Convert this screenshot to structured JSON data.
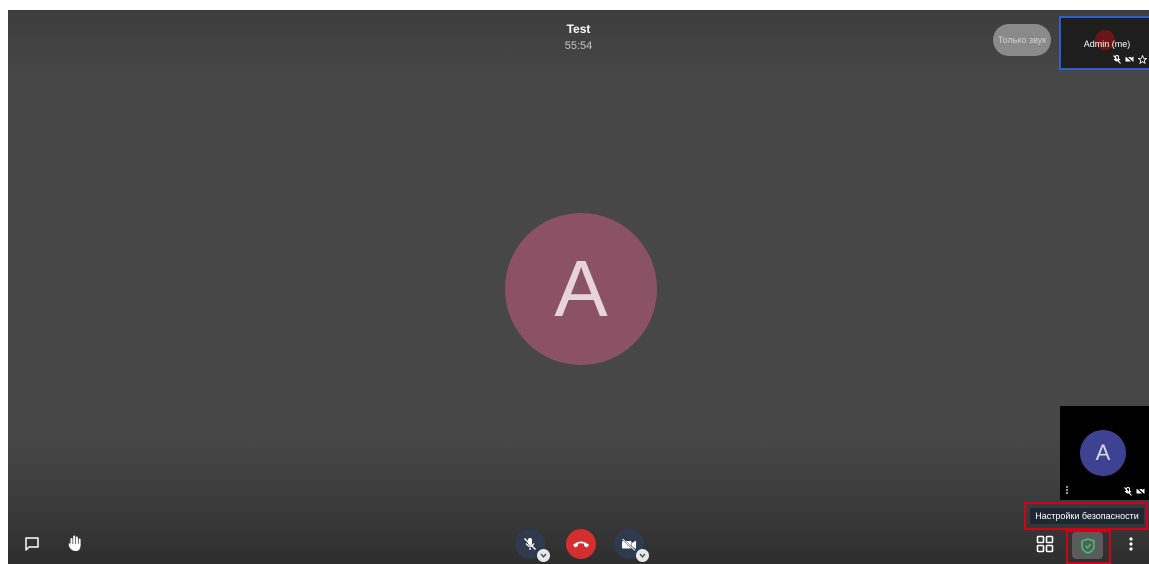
{
  "meeting": {
    "title": "Test",
    "timer": "55:54"
  },
  "main_avatar_initial": "A",
  "audio_only_label": "Только звук",
  "self_view": {
    "name": "Admin (me)",
    "icons": [
      "mic-muted-icon",
      "camera-off-icon",
      "star-icon"
    ]
  },
  "participant_tile": {
    "initial": "A",
    "icons": [
      "more-vertical-icon",
      "mic-muted-icon",
      "camera-off-icon"
    ]
  },
  "tooltip": {
    "text": "Настройки безопасности"
  },
  "toolbar": {
    "left": [
      "chat-icon",
      "raise-hand-icon"
    ],
    "center": [
      "microphone-muted-button",
      "hangup-button",
      "camera-off-button"
    ],
    "right": [
      "tile-view-icon",
      "security-shield-icon",
      "more-options-icon"
    ]
  },
  "colors": {
    "background": "#474747",
    "main_avatar": "#8a5264",
    "participant_avatar": "#3f4193",
    "hangup": "#d32f2f",
    "highlight": "#d0021b",
    "self_border": "#2f5ec4",
    "security_shield": "#39c46a"
  }
}
